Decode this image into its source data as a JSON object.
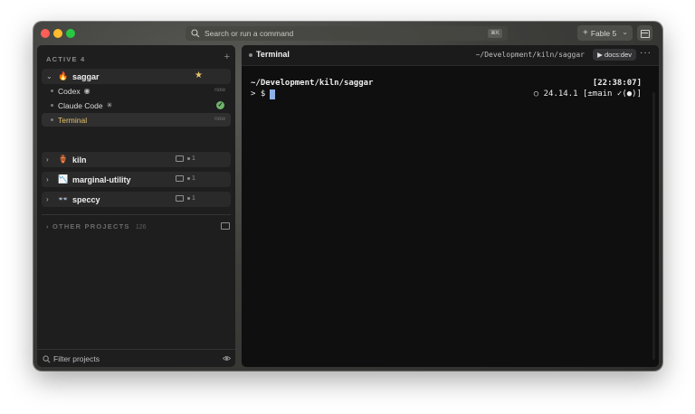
{
  "titlebar": {
    "search_placeholder": "Search or run a command",
    "search_shortcut": "⌘K",
    "model_label": "Fable 5",
    "model_chevron": "⌄"
  },
  "sidebar": {
    "active_title": "ACTIVE 4",
    "add_label": "+",
    "projects": [
      {
        "name": "saggar",
        "icon": "🔥",
        "chevron": "⌄",
        "starred": true,
        "star": "★",
        "sessions": [
          {
            "name": "Codex",
            "glyph": "◉",
            "right": "now",
            "active": false
          },
          {
            "name": "Claude Code",
            "glyph": "✳",
            "right": "✓",
            "active": false
          },
          {
            "name": "Terminal",
            "glyph": "",
            "right": "now",
            "active": true
          }
        ]
      },
      {
        "name": "kiln",
        "icon": "🏺",
        "chevron": "›",
        "meta_count": "1"
      },
      {
        "name": "marginal-utility",
        "icon": "📉",
        "chevron": "›",
        "meta_count": "1"
      },
      {
        "name": "speccy",
        "icon": "👓",
        "chevron": "›",
        "meta_count": "1"
      }
    ],
    "other_title": "OTHER PROJECTS",
    "other_count": "126",
    "other_chevron": "›",
    "filter_placeholder": "Filter projects"
  },
  "terminal": {
    "title": "Terminal",
    "path": "~/Development/kiln/saggar",
    "run_label": "▶ docs:dev",
    "more": "···",
    "line1": "~/Development/kiln/saggar",
    "time": "[22:38:07]",
    "prompt": "> $",
    "status": "○ 24.14.1 [±main ✓(●)]"
  },
  "colors": {
    "accent_yellow": "#e6c36a",
    "ok_green": "#6fb36b",
    "cursor_blue": "#8fb2e6"
  }
}
